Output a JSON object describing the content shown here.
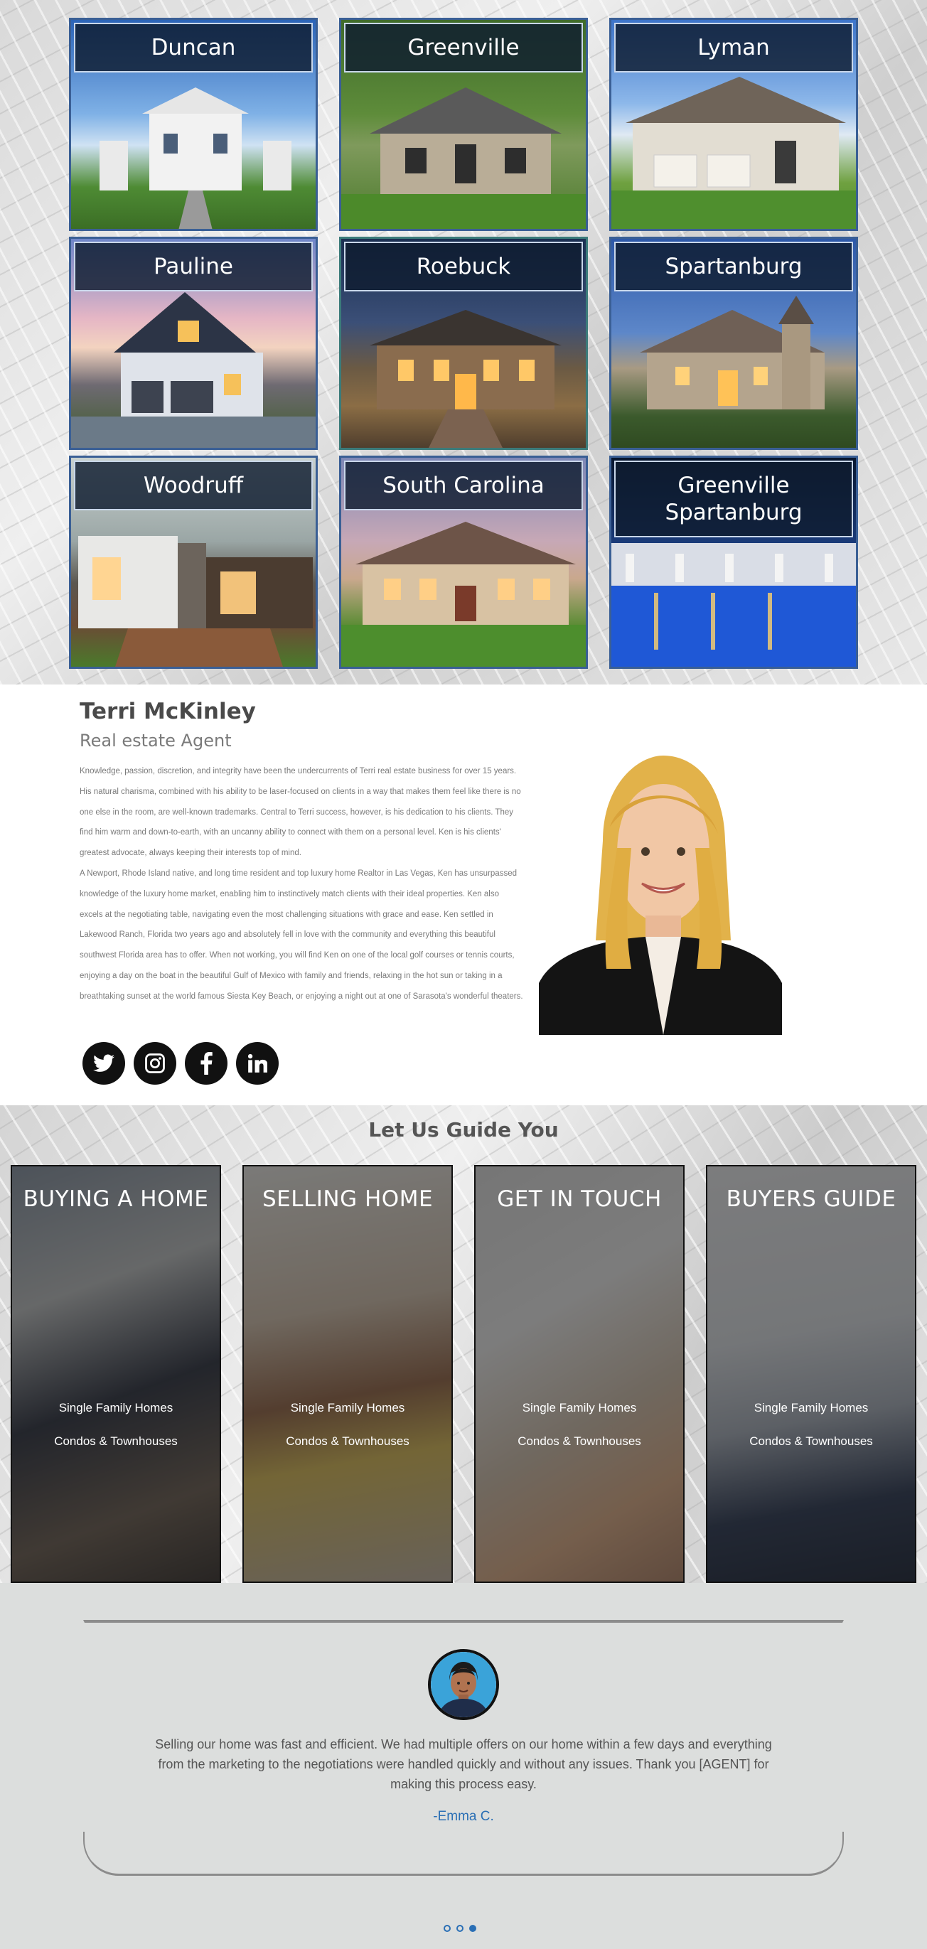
{
  "cities": [
    {
      "name": "Duncan"
    },
    {
      "name": "Greenville"
    },
    {
      "name": "Lyman"
    },
    {
      "name": "Pauline"
    },
    {
      "name": "Roebuck"
    },
    {
      "name": "Spartanburg"
    },
    {
      "name": "Woodruff"
    },
    {
      "name": "South Carolina"
    },
    {
      "name": "Greenville\nSpartanburg"
    }
  ],
  "agent": {
    "name": "Terri McKinley",
    "role": "Real estate Agent",
    "bio_p1": "Knowledge, passion, discretion, and integrity have been the undercurrents of Terri real estate business for over 15 years. His natural charisma, combined with his ability to be laser-focused on clients in a way that makes them feel like there is no one else in the room, are well-known trademarks. Central to Terri success, however, is his dedication to his clients. They find him warm and down-to-earth, with an uncanny ability to connect with them on a personal level. Ken is his clients' greatest advocate, always keeping their interests top of mind.",
    "bio_p2": "A Newport, Rhode Island native, and long time resident and top luxury home Realtor in Las Vegas, Ken has unsurpassed knowledge of the luxury home market, enabling him to instinctively match clients with their ideal properties. Ken also excels at the negotiating table, navigating even the most challenging situations with grace and ease.  Ken settled in Lakewood Ranch, Florida two years ago and absolutely fell in love with the community and everything this beautiful southwest Florida area has to offer. When not working, you will find Ken on one of the local golf courses or tennis courts, enjoying a day on the boat in the beautiful Gulf of Mexico with family and friends, relaxing in the hot sun or taking in a breathtaking sunset at the world famous Siesta Key Beach, or enjoying a night out at one of Sarasota's wonderful theaters."
  },
  "socials": [
    {
      "icon": "twitter-icon"
    },
    {
      "icon": "instagram-icon"
    },
    {
      "icon": "facebook-icon"
    },
    {
      "icon": "linkedin-icon"
    }
  ],
  "guide": {
    "title": "Let Us Guide You",
    "cards": [
      {
        "heading": "BUYING A HOME",
        "link1": "Single Family Homes",
        "link2": "Condos & Townhouses"
      },
      {
        "heading": "SELLING HOME",
        "link1": "Single Family Homes",
        "link2": "Condos & Townhouses"
      },
      {
        "heading": "GET IN TOUCH",
        "link1": "Single Family Homes",
        "link2": "Condos & Townhouses"
      },
      {
        "heading": "BUYERS GUIDE",
        "link1": "Single Family Homes",
        "link2": "Condos & Townhouses"
      }
    ]
  },
  "testimonial": {
    "text": "Selling our home was fast and efficient. We had multiple offers on our home within a few days and everything from the marketing to the negotiations were handled quickly and without any issues. Thank you [AGENT] for making this process easy.",
    "author": "-Emma C.",
    "slides": 3,
    "active_slide": 3
  },
  "colors": {
    "card_border": "#3a5f95",
    "label_bg": "#0f1c30",
    "link_blue": "#2a6fb5",
    "testimonial_bg": "#dcdedd"
  }
}
